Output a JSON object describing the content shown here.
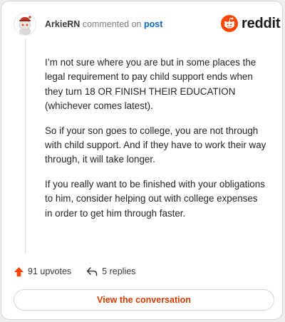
{
  "header": {
    "author": "ArkieRN",
    "action": "commented on",
    "target": "post"
  },
  "brand": {
    "name": "reddit",
    "icon": "reddit-logo-icon",
    "color": "#ff4500"
  },
  "comment": {
    "paragraphs": [
      "I’m not sure where you are but in some places the legal requirement to pay child support ends when they turn 18 OR FINISH THEIR EDUCATION (whichever comes latest).",
      "So if your son goes to college, you are not through with child support. And if they have to work their way through, it will take longer.",
      "If you really want to be finished with your obligations to him, consider helping out with college expenses in order to get him through faster."
    ]
  },
  "footer": {
    "upvotes": "91 upvotes",
    "replies": "5 replies",
    "upvote_icon": "upvote-arrow-icon",
    "reply_icon": "reply-arrow-icon"
  },
  "cta": {
    "label": "View the conversation",
    "color": "#d93a00"
  }
}
